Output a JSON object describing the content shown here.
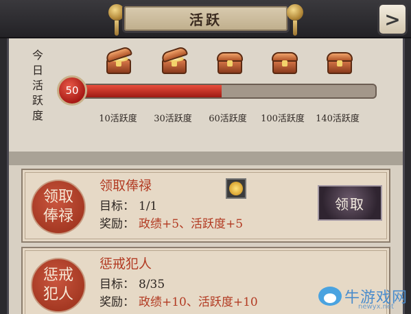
{
  "header": {
    "title": "活跃",
    "back_icon": "chevron-right-icon"
  },
  "activity": {
    "label": "今日活跃度",
    "current_value": "50",
    "progress_fraction": 0.5,
    "milestones": [
      {
        "label": "10活跃度",
        "chest": "open-chest-icon"
      },
      {
        "label": "30活跃度",
        "chest": "open-chest-icon"
      },
      {
        "label": "60活跃度",
        "chest": "closed-chest-icon"
      },
      {
        "label": "100活跃度",
        "chest": "closed-chest-icon"
      },
      {
        "label": "140活跃度",
        "chest": "closed-chest-icon"
      }
    ]
  },
  "tasks": [
    {
      "seal": "领取俸禄",
      "name": "领取俸禄",
      "target_label": "目标：",
      "target_value": "1/1",
      "reward_label": "奖励：",
      "reward_value": "政绩+5、活跃度+5",
      "icon": "gold-coin-icon",
      "button": "领取"
    },
    {
      "seal": "惩戒犯人",
      "name": "惩戒犯人",
      "target_label": "目标：",
      "target_value": "8/35",
      "reward_label": "奖励：",
      "reward_value": "政绩+10、活跃度+10"
    }
  ],
  "watermark": {
    "text": "牛游戏网",
    "url": "newyx.net"
  },
  "colors": {
    "accent_red": "#b23a22",
    "progress_red": "#c7281c",
    "parchment": "#d8d0c3"
  }
}
